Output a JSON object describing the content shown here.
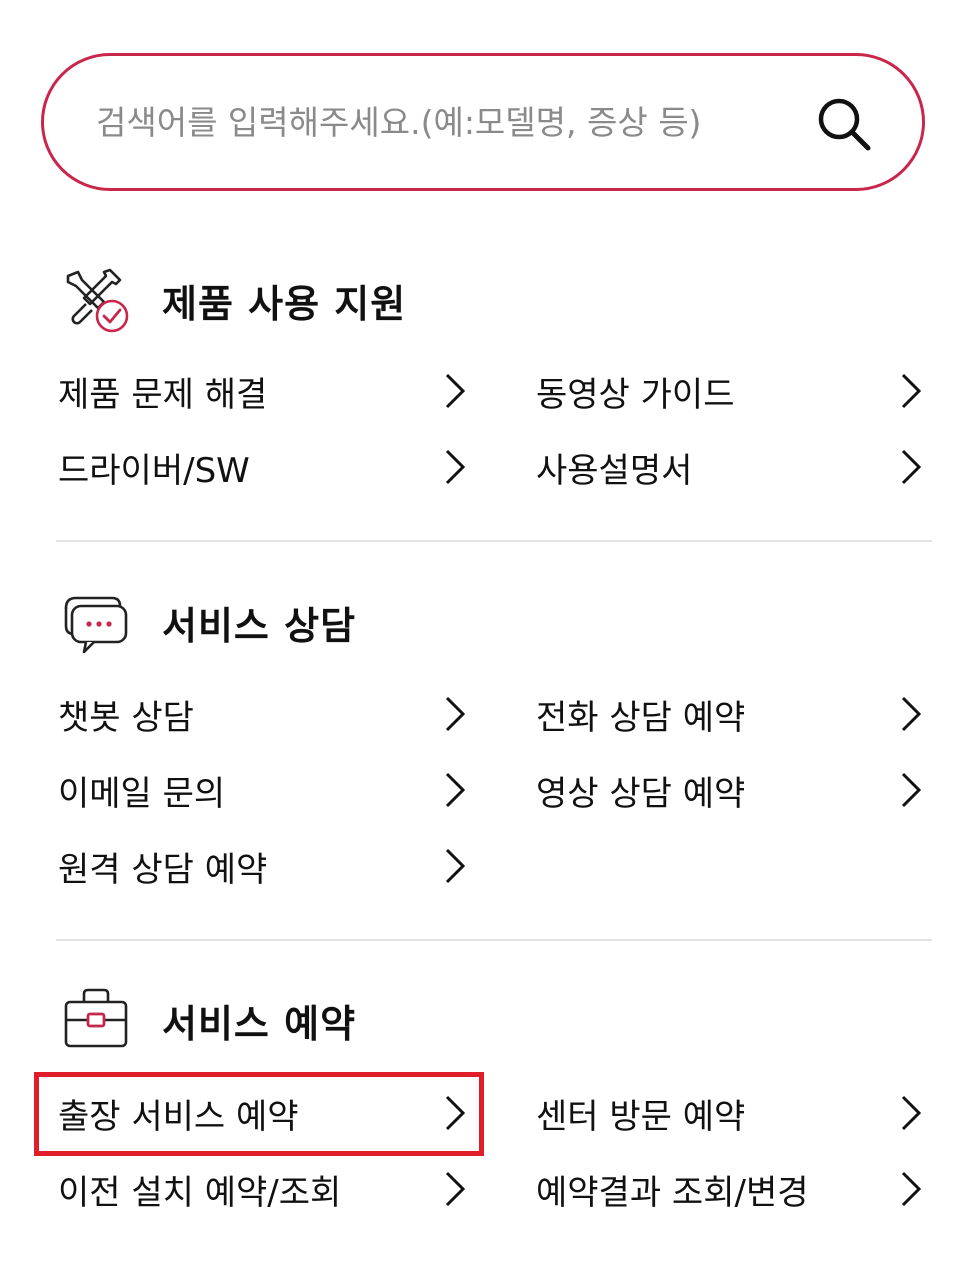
{
  "search": {
    "placeholder": "검색어를 입력해주세요.(예:모델명, 증상 등)",
    "value": "",
    "icon": "search-icon"
  },
  "accent_color": "#c8264b",
  "highlight_color": "#e01e2a",
  "sections": [
    {
      "title": "제품 사용 지원",
      "icon": "tools-check-icon",
      "links": [
        {
          "label": "제품 문제 해결"
        },
        {
          "label": "동영상 가이드"
        },
        {
          "label": "드라이버/SW"
        },
        {
          "label": "사용설명서"
        }
      ]
    },
    {
      "title": "서비스 상담",
      "icon": "chat-bubbles-icon",
      "links": [
        {
          "label": "챗봇 상담"
        },
        {
          "label": "전화 상담 예약"
        },
        {
          "label": "이메일 문의"
        },
        {
          "label": "영상 상담 예약"
        },
        {
          "label": "원격 상담 예약"
        }
      ]
    },
    {
      "title": "서비스 예약",
      "icon": "toolbox-icon",
      "links": [
        {
          "label": "출장 서비스 예약",
          "highlighted": true
        },
        {
          "label": "센터 방문 예약"
        },
        {
          "label": "이전 설치 예약/조회"
        },
        {
          "label": "예약결과 조회/변경"
        }
      ]
    }
  ]
}
